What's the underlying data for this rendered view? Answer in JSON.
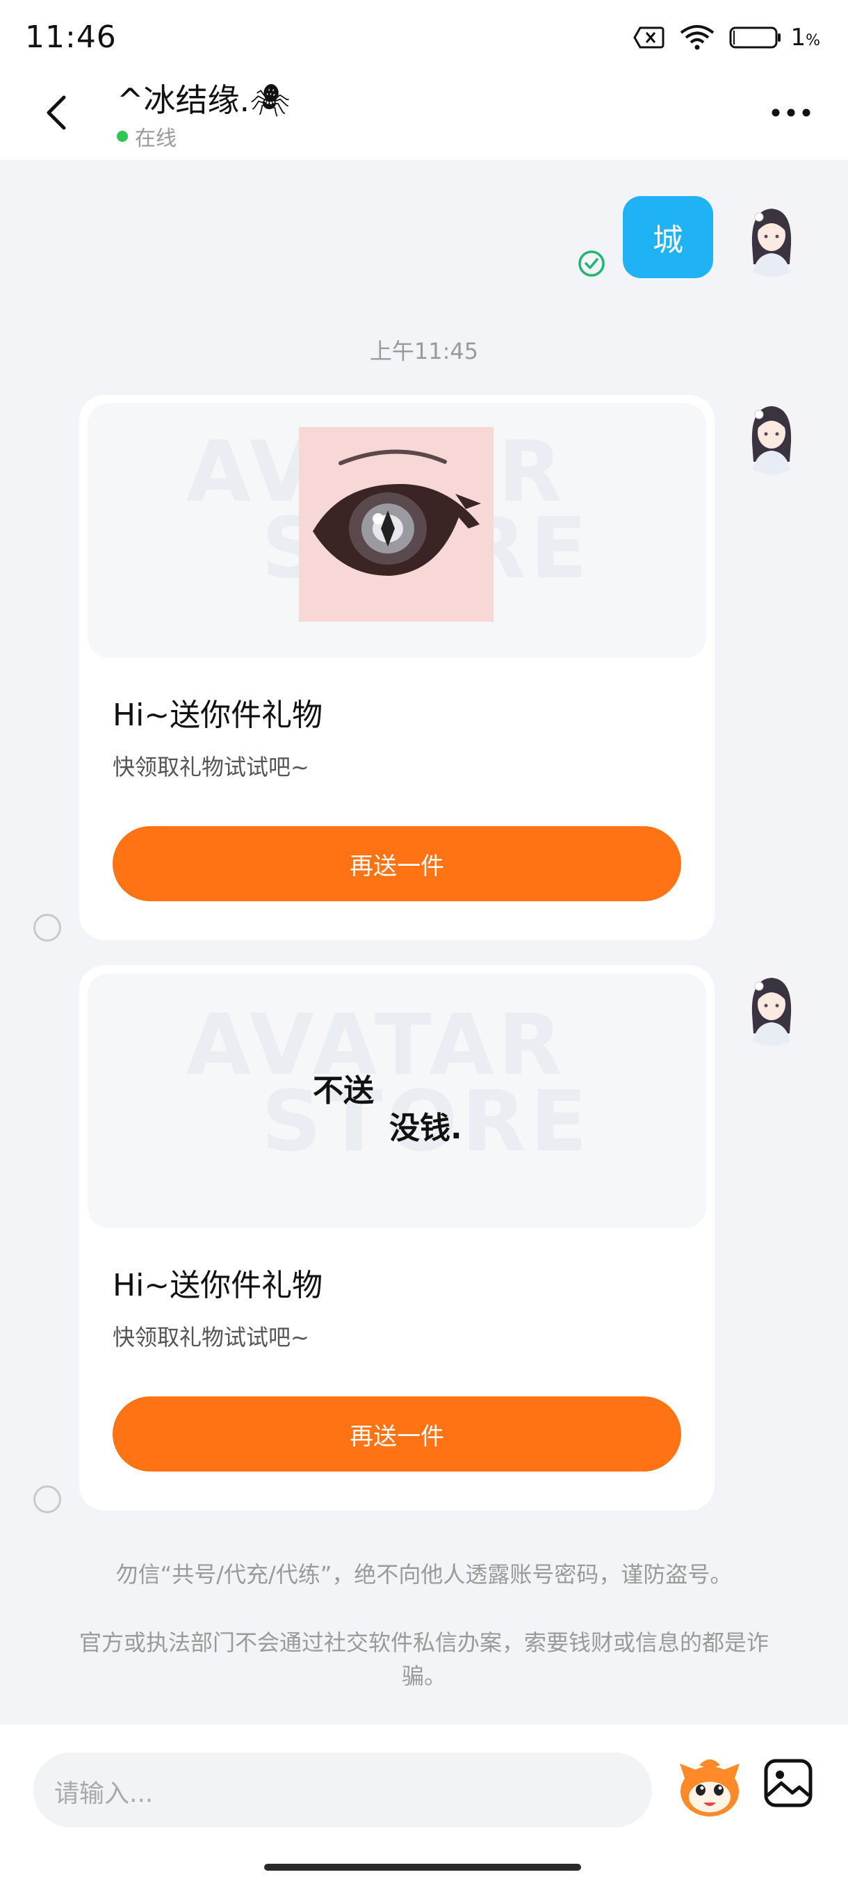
{
  "status_bar": {
    "time": "11:46",
    "battery": "1",
    "battery_unit": "%",
    "icons": [
      "sim-blocked-icon",
      "wifi-icon",
      "battery-icon"
    ]
  },
  "header": {
    "title": "^冰结缘.🕷",
    "status": "在线",
    "back_icon": "back-chevron-icon",
    "more_icon": "more-dots-icon"
  },
  "chat": {
    "outgoing_message": {
      "text": "城",
      "read": true
    },
    "timestamp": "上午11:45",
    "cards": [
      {
        "image": "eye-illustration",
        "watermark_line1": "AVATAR",
        "watermark_line2": "STORE",
        "title": "Hi~送你件礼物",
        "subtitle": "快领取礼物试试吧~",
        "button": "再送一件"
      },
      {
        "image": "handwritten-text-image",
        "image_text_line1": "不送",
        "image_text_line2": "没钱.",
        "watermark_line1": "AVATAR",
        "watermark_line2": "STORE",
        "title": "Hi~送你件礼物",
        "subtitle": "快领取礼物试试吧~",
        "button": "再送一件"
      }
    ],
    "notices": [
      "勿信“共号/代充/代练”，绝不向他人透露账号密码，谨防盗号。",
      "官方或执法部门不会通过社交软件私信办案，索要钱财或信息的都是诈骗。"
    ]
  },
  "input_bar": {
    "placeholder": "请输入...",
    "emoji_icon": "mascot-emoji-icon",
    "image_icon": "image-gallery-icon"
  },
  "colors": {
    "accent_orange": "#ff7314",
    "bubble_blue": "#1fb2f5",
    "online_green": "#2dc653",
    "chat_background": "#f2f4f7"
  }
}
